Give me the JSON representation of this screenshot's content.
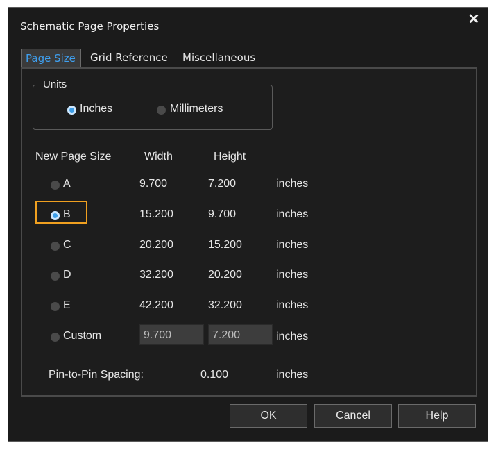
{
  "window": {
    "title": "Schematic Page Properties",
    "close_glyph": "✕"
  },
  "tabs": [
    {
      "label": "Page Size",
      "active": true
    },
    {
      "label": "Grid Reference",
      "active": false
    },
    {
      "label": "Miscellaneous",
      "active": false
    }
  ],
  "units": {
    "legend": "Units",
    "options": [
      {
        "label": "Inches",
        "selected": true
      },
      {
        "label": "Millimeters",
        "selected": false
      }
    ]
  },
  "page_size": {
    "headers": {
      "name": "New Page Size",
      "width": "Width",
      "height": "Height"
    },
    "rows": [
      {
        "label": "A",
        "width": "9.700",
        "height": "7.200",
        "unit": "inches",
        "selected": false
      },
      {
        "label": "B",
        "width": "15.200",
        "height": "9.700",
        "unit": "inches",
        "selected": true
      },
      {
        "label": "C",
        "width": "20.200",
        "height": "15.200",
        "unit": "inches",
        "selected": false
      },
      {
        "label": "D",
        "width": "32.200",
        "height": "20.200",
        "unit": "inches",
        "selected": false
      },
      {
        "label": "E",
        "width": "42.200",
        "height": "32.200",
        "unit": "inches",
        "selected": false
      }
    ],
    "custom": {
      "label": "Custom",
      "width": "9.700",
      "height": "7.200",
      "unit": "inches",
      "selected": false
    }
  },
  "pin_spacing": {
    "label": "Pin-to-Pin Spacing:",
    "value": "0.100",
    "unit": "inches"
  },
  "buttons": {
    "ok": "OK",
    "cancel": "Cancel",
    "help": "Help"
  },
  "colors": {
    "accent": "#3fa0f0",
    "highlight": "#f0a020",
    "background": "#1b1b1b"
  }
}
